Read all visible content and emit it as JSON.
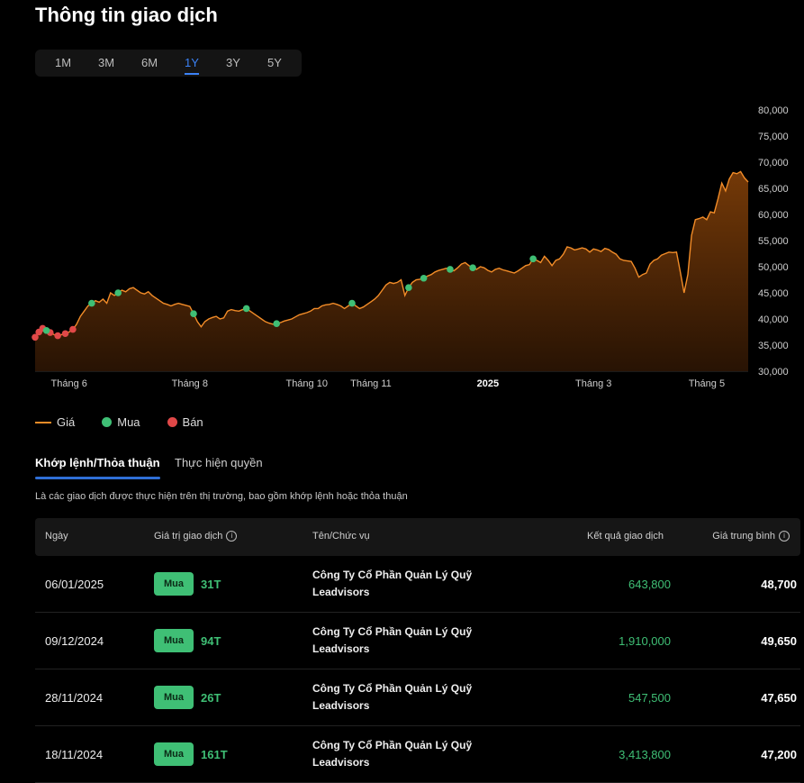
{
  "title": "Thông tin giao dịch",
  "range_tabs": [
    "1M",
    "3M",
    "6M",
    "1Y",
    "3Y",
    "5Y"
  ],
  "active_range": "1Y",
  "colors": {
    "price": "#f28c28",
    "buy": "#3fbf75",
    "sell": "#e04848",
    "accent": "#3b82f6"
  },
  "chart_data": {
    "type": "line",
    "y_ticks": [
      "30,000",
      "35,000",
      "40,000",
      "45,000",
      "50,000",
      "55,000",
      "60,000",
      "65,000",
      "70,000",
      "75,000",
      "80,000"
    ],
    "ylim": [
      30000,
      80000
    ],
    "x_ticks": [
      {
        "label": "Tháng 6",
        "bold": false,
        "i": 9
      },
      {
        "label": "Tháng 8",
        "bold": false,
        "i": 41
      },
      {
        "label": "Tháng 10",
        "bold": false,
        "i": 72
      },
      {
        "label": "Tháng 11",
        "bold": false,
        "i": 89
      },
      {
        "label": "2025",
        "bold": true,
        "i": 120
      },
      {
        "label": "Tháng 3",
        "bold": false,
        "i": 148
      },
      {
        "label": "Tháng 5",
        "bold": false,
        "i": 178
      }
    ],
    "series": [
      {
        "name": "Giá",
        "values": [
          36500,
          37500,
          38200,
          37800,
          37400,
          37000,
          36800,
          37000,
          37200,
          37500,
          38000,
          39000,
          40500,
          41500,
          42500,
          43000,
          43500,
          43200,
          43800,
          43000,
          45000,
          44500,
          45000,
          45500,
          45200,
          45800,
          46000,
          45500,
          45000,
          44800,
          45200,
          44500,
          44000,
          43500,
          43000,
          42800,
          42500,
          42800,
          43000,
          42800,
          42600,
          42400,
          41000,
          39500,
          38500,
          39500,
          40000,
          40300,
          40500,
          40000,
          40200,
          41500,
          41800,
          41600,
          41500,
          41800,
          42000,
          41500,
          41000,
          40500,
          40000,
          39500,
          39200,
          39000,
          39100,
          39300,
          39600,
          39800,
          40000,
          40400,
          40800,
          41000,
          41200,
          41500,
          42000,
          42000,
          42500,
          42700,
          42800,
          43000,
          42800,
          42500,
          42000,
          42500,
          43000,
          42500,
          42000,
          42300,
          42800,
          43300,
          43800,
          44500,
          45500,
          46500,
          47000,
          46800,
          47000,
          47500,
          44500,
          46000,
          47000,
          47500,
          47600,
          47800,
          48200,
          48500,
          49000,
          49300,
          49500,
          49700,
          49500,
          49200,
          49800,
          50500,
          50800,
          50200,
          49800,
          49500,
          50000,
          49800,
          49300,
          49000,
          49500,
          49700,
          49400,
          49200,
          49000,
          48800,
          49200,
          49700,
          50200,
          50400,
          51500,
          51200,
          50800,
          52000,
          51200,
          50200,
          51200,
          51500,
          52400,
          53800,
          53600,
          53200,
          53400,
          53600,
          53400,
          52800,
          53400,
          53200,
          52900,
          53500,
          53300,
          52800,
          52400,
          51500,
          51200,
          51100,
          51000,
          49700,
          48000,
          48500,
          48800,
          50500,
          51200,
          51500,
          52200,
          52500,
          52800,
          52700,
          52800,
          49000,
          45000,
          48500,
          56000,
          59000,
          59200,
          59500,
          59000,
          60500,
          60300,
          63000,
          66000,
          64500,
          66800,
          68000,
          67800,
          68200,
          67000,
          66200
        ],
        "color": "#f28c28"
      }
    ],
    "buy_points": [
      3,
      15,
      22,
      42,
      56,
      64,
      84,
      99,
      103,
      110,
      116,
      132
    ],
    "sell_points": [
      0,
      1,
      2,
      4,
      6,
      8,
      10
    ],
    "legend": [
      {
        "type": "line",
        "label": "Giá",
        "color": "#f28c28"
      },
      {
        "type": "dot",
        "label": "Mua",
        "color": "#3fbf75"
      },
      {
        "type": "dot",
        "label": "Bán",
        "color": "#e04848"
      }
    ]
  },
  "tabs": [
    "Khớp lệnh/Thỏa thuận",
    "Thực hiện quyền"
  ],
  "description": "Là các giao dịch được thực hiện trên thị trường, bao gồm khớp lệnh hoặc thỏa thuận",
  "table": {
    "headers": [
      "Ngày",
      "Giá trị giao dịch",
      "Tên/Chức vụ",
      "Kết quả giao dịch",
      "Giá trung bình"
    ],
    "info_icon": "ⓘ",
    "rows": [
      {
        "date": "06/01/2025",
        "side": "Mua",
        "value": "31T",
        "name": "Công Ty Cổ Phần Quản Lý Quỹ Leadvisors",
        "result": "643,800",
        "avg": "48,700"
      },
      {
        "date": "09/12/2024",
        "side": "Mua",
        "value": "94T",
        "name": "Công Ty Cổ Phần Quản Lý Quỹ Leadvisors",
        "result": "1,910,000",
        "avg": "49,650"
      },
      {
        "date": "28/11/2024",
        "side": "Mua",
        "value": "26T",
        "name": "Công Ty Cổ Phần Quản Lý Quỹ Leadvisors",
        "result": "547,500",
        "avg": "47,650"
      },
      {
        "date": "18/11/2024",
        "side": "Mua",
        "value": "161T",
        "name": "Công Ty Cổ Phần Quản Lý Quỹ Leadvisors",
        "result": "3,413,800",
        "avg": "47,200"
      }
    ]
  }
}
